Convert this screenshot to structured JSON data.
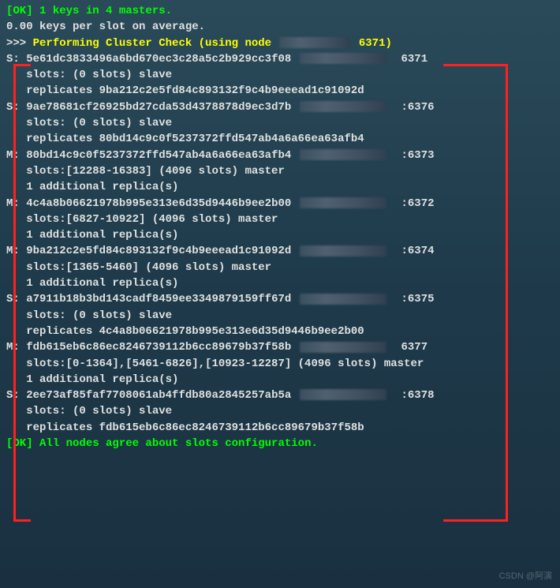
{
  "header": {
    "ok_prefix": "[OK]",
    "ok_msg": " 1 keys in 4 masters.",
    "avg_line": "0.00 keys per slot on average.",
    "check_prefix": ">>> ",
    "check_msg": "Performing Cluster Check (using node ",
    "check_port": " 6371)"
  },
  "nodes": [
    {
      "role": "S:",
      "hash": "5e61dc3833496a6bd670ec3c28a5c2b929cc3f08",
      "port": "6371",
      "slots_line": "   slots: (0 slots) slave",
      "extra_line": "   replicates 9ba212c2e5fd84c893132f9c4b9eeead1c91092d"
    },
    {
      "role": "S:",
      "hash": "9ae78681cf26925bd27cda53d4378878d9ec3d7b",
      "port": ":6376",
      "slots_line": "   slots: (0 slots) slave",
      "extra_line": "   replicates 80bd14c9c0f5237372ffd547ab4a6a66ea63afb4"
    },
    {
      "role": "M:",
      "hash": "80bd14c9c0f5237372ffd547ab4a6a66ea63afb4",
      "port": ":6373",
      "slots_line": "   slots:[12288-16383] (4096 slots) master",
      "extra_line": "   1 additional replica(s)"
    },
    {
      "role": "M:",
      "hash": "4c4a8b06621978b995e313e6d35d9446b9ee2b00",
      "port": ":6372",
      "slots_line": "   slots:[6827-10922] (4096 slots) master",
      "extra_line": "   1 additional replica(s)"
    },
    {
      "role": "M:",
      "hash": "9ba212c2e5fd84c893132f9c4b9eeead1c91092d",
      "port": ":6374",
      "slots_line": "   slots:[1365-5460] (4096 slots) master",
      "extra_line": "   1 additional replica(s)"
    },
    {
      "role": "S:",
      "hash": "a7911b18b3bd143cadf8459ee3349879159ff67d",
      "port": ":6375",
      "slots_line": "   slots: (0 slots) slave",
      "extra_line": "   replicates 4c4a8b06621978b995e313e6d35d9446b9ee2b00"
    },
    {
      "role": "M:",
      "hash": "fdb615eb6c86ec8246739112b6cc89679b37f58b",
      "port": "6377",
      "slots_line": "   slots:[0-1364],[5461-6826],[10923-12287] (4096 slots) master",
      "extra_line": "   1 additional replica(s)"
    },
    {
      "role": "S:",
      "hash": "2ee73af85faf7708061ab4ffdb80a2845257ab5a",
      "port": ":6378",
      "slots_line": "   slots: (0 slots) slave",
      "extra_line": "   replicates fdb615eb6c86ec8246739112b6cc89679b37f58b"
    }
  ],
  "footer": {
    "ok_prefix": "[OK]",
    "ok_msg": " All nodes agree about slots configuration."
  },
  "watermark": "CSDN @阿演"
}
